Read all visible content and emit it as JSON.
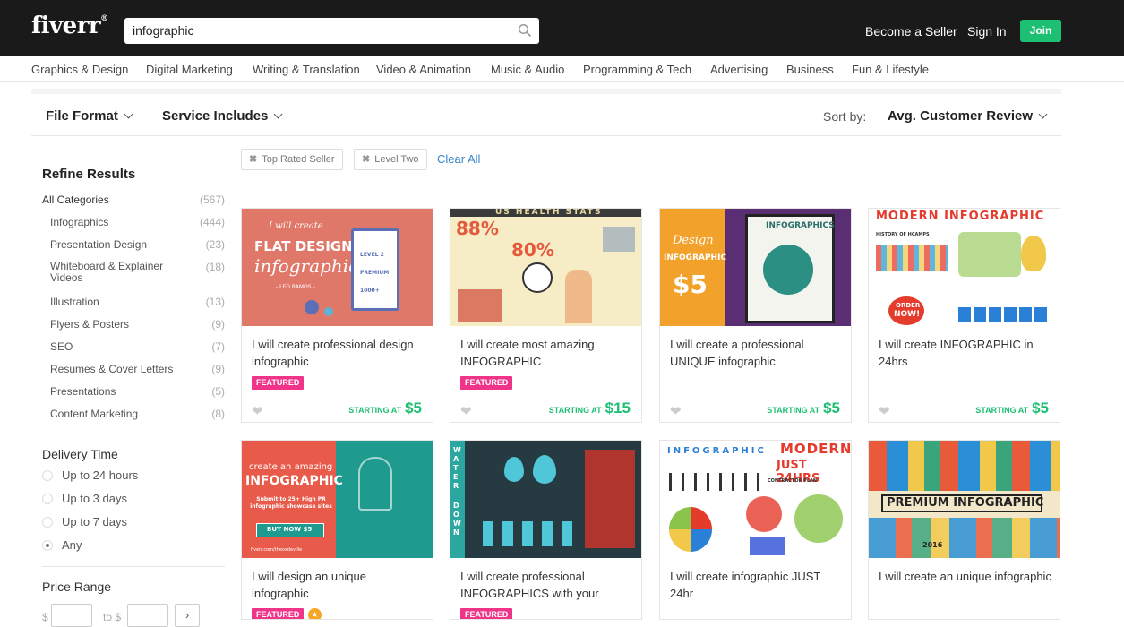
{
  "header": {
    "logo": "fiverr",
    "logo_mark": "®",
    "search_value": "infographic",
    "become_seller": "Become a Seller",
    "sign_in": "Sign In",
    "join": "Join"
  },
  "categories_nav": [
    "Graphics & Design",
    "Digital Marketing",
    "Writing & Translation",
    "Video & Animation",
    "Music & Audio",
    "Programming & Tech",
    "Advertising",
    "Business",
    "Fun & Lifestyle"
  ],
  "filters": {
    "file_format": "File Format",
    "service_includes": "Service Includes",
    "sort_label": "Sort by:",
    "sort_value": "Avg. Customer Review"
  },
  "chips": [
    "Top Rated Seller",
    "Level Two"
  ],
  "clear_all": "Clear All",
  "sidebar": {
    "title": "Refine Results",
    "all_categories": {
      "label": "All Categories",
      "count": "(567)"
    },
    "items": [
      {
        "label": "Infographics",
        "count": "(444)"
      },
      {
        "label": "Presentation Design",
        "count": "(23)"
      },
      {
        "label": "Whiteboard & Explainer Videos",
        "count": "(18)"
      },
      {
        "label": "Illustration",
        "count": "(13)"
      },
      {
        "label": "Flyers & Posters",
        "count": "(9)"
      },
      {
        "label": "SEO",
        "count": "(7)"
      },
      {
        "label": "Resumes & Cover Letters",
        "count": "(9)"
      },
      {
        "label": "Presentations",
        "count": "(5)"
      },
      {
        "label": "Content Marketing",
        "count": "(8)"
      }
    ],
    "delivery_title": "Delivery Time",
    "delivery_options": [
      "Up to 24 hours",
      "Up to 3 days",
      "Up to 7 days",
      "Any"
    ],
    "delivery_selected": "Any",
    "price_title": "Price Range",
    "price_currency": "$",
    "price_to": "to $",
    "price_go": "›"
  },
  "gigs": [
    {
      "title": "I will create professional design infographic",
      "badge": "FEATURED",
      "starting": "STARTING AT",
      "price": "$5",
      "thumb": {
        "l1": "I will create",
        "l2": "FLAT DESIGN",
        "l3": "infographic",
        "l4": "- LEO RAMOS -",
        "r1": "LEVEL 2",
        "r2": "PREMIUM",
        "r3": "1000+"
      }
    },
    {
      "title": "I will create most amazing INFOGRAPHIC",
      "badge": "FEATURED",
      "starting": "STARTING AT",
      "price": "$15",
      "thumb": {
        "h": "US HEALTH STATS",
        "p1": "88%",
        "p2": "80%"
      }
    },
    {
      "title": "I will create a professional UNIQUE infographic",
      "badge": "",
      "starting": "STARTING AT",
      "price": "$5",
      "thumb": {
        "a": "Design",
        "b": "INFOGRAPHIC",
        "c": "$5",
        "d": "INFOGRAPHICS"
      }
    },
    {
      "title": "I will create INFOGRAPHIC in 24hrs",
      "badge": "",
      "starting": "STARTING AT",
      "price": "$5",
      "thumb": {
        "h": "MODERN INFOGRAPHIC",
        "s": "HISTORY OF HCAMPS",
        "o1": "ORDER",
        "o2": "NOW!"
      }
    },
    {
      "title": "I will design an unique infographic",
      "badge": "FEATURED",
      "starting": "",
      "price": "",
      "thumb": {
        "a": "create an amazing",
        "b": "INFOGRAPHIC",
        "c": "Submit to 25+ High PR infographic showcase sites",
        "d": "BUY NOW $5",
        "e": "fiverr.com/theoxdeville"
      }
    },
    {
      "title": "I will create professional INFOGRAPHICS with your",
      "badge": "FEATURED",
      "starting": "",
      "price": "",
      "thumb": {
        "v": "WATER",
        "v2": "DOWN"
      }
    },
    {
      "title": "I will create infographic JUST 24hr",
      "badge": "",
      "starting": "",
      "price": "",
      "thumb": {
        "h1": "INFOGRAPHIC",
        "h2": "MODERN",
        "h3": "JUST 24HRS",
        "s": "CONTRACTOR PLAN"
      }
    },
    {
      "title": "I will create an unique infographic",
      "badge": "",
      "starting": "",
      "price": "",
      "thumb": {
        "h": "PREMIUM INFOGRAPHIC",
        "y": "2016"
      }
    }
  ]
}
